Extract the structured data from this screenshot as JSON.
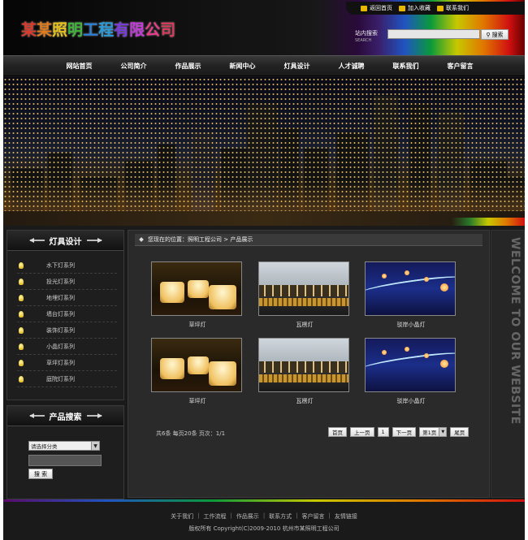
{
  "header": {
    "logo_chars": [
      {
        "char": "某",
        "color": "#d93a2a"
      },
      {
        "char": "某",
        "color": "#e07a1a"
      },
      {
        "char": "照",
        "color": "#e8c21a"
      },
      {
        "char": "明",
        "color": "#3fb23a"
      },
      {
        "char": "工",
        "color": "#2a7fd9"
      },
      {
        "char": "程",
        "color": "#2a9ad9"
      },
      {
        "char": "有",
        "color": "#7a3ad9"
      },
      {
        "char": "限",
        "color": "#c23ad9"
      },
      {
        "char": "公",
        "color": "#e83a8a"
      },
      {
        "char": "司",
        "color": "#d93a5a"
      }
    ],
    "top_links": [
      {
        "label": "返回首页",
        "icon": "home-icon"
      },
      {
        "label": "加入收藏",
        "icon": "favorite-icon"
      },
      {
        "label": "联系我们",
        "icon": "mail-icon"
      }
    ],
    "search_label": "站内搜索",
    "search_label_en": "SEARCH",
    "search_value": "",
    "search_button": "搜索"
  },
  "nav": [
    "网站首页",
    "公司简介",
    "作品展示",
    "新闻中心",
    "灯具设计",
    "人才诚聘",
    "联系我们",
    "客户留言"
  ],
  "sidebar": {
    "categories_title": "灯具设计",
    "categories": [
      "水下灯系列",
      "投光灯系列",
      "地埋灯系列",
      "墙台灯系列",
      "装饰灯系列",
      "小晶灯系列",
      "草坪灯系列",
      "庭院灯系列"
    ],
    "product_search_title": "产品搜索",
    "select_value": "请选择分类",
    "keyword_value": "",
    "search_button": "搜 索"
  },
  "main": {
    "breadcrumb": "您现在的位置：照明工程公司 > 产品展示",
    "products": [
      {
        "title": "草坪灯",
        "image": "glowing-lounge-furniture"
      },
      {
        "title": "瓦楞灯",
        "image": "roof-tile-lights"
      },
      {
        "title": "驳岸小晶灯",
        "image": "blue-waterfront-lights"
      },
      {
        "title": "草坪灯",
        "image": "glowing-lounge-furniture"
      },
      {
        "title": "瓦楞灯",
        "image": "roof-tile-lights"
      },
      {
        "title": "驳岸小晶灯",
        "image": "blue-waterfront-lights"
      }
    ],
    "pager_info": "共6条  每页20条  页次：1/1",
    "pager": {
      "first": "首页",
      "prev": "上一页",
      "current": "1",
      "next": "下一页",
      "select": "第1页",
      "last": "尾页"
    }
  },
  "welcome_text": "WELCOME TO OUR WEBSITE",
  "footer": {
    "links": [
      "关于我们",
      "工作流程",
      "作品展示",
      "联系方式",
      "客户留言",
      "友情链接"
    ],
    "copyright": "版权所有  Copyright(C)2009-2010 杭州市某照明工程公司"
  }
}
